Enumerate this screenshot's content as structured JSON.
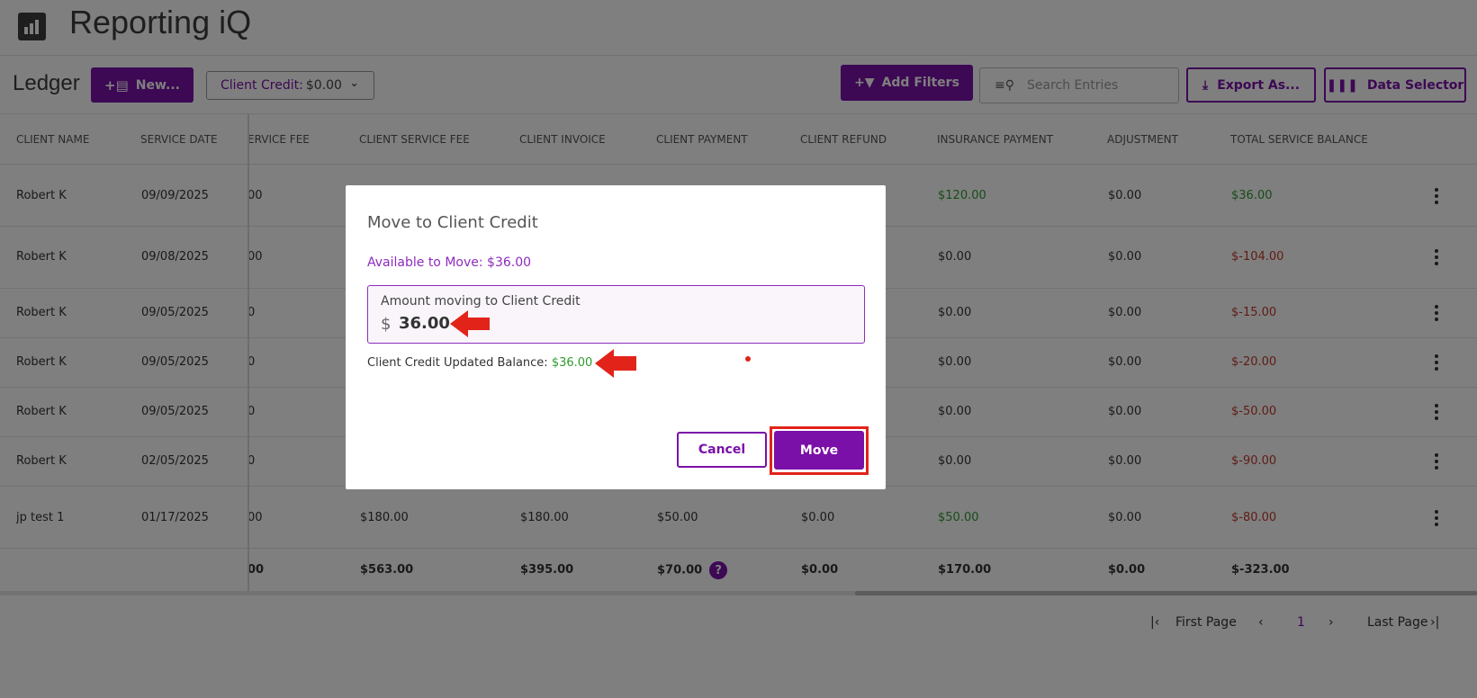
{
  "app": {
    "title": "Reporting iQ"
  },
  "toolbar": {
    "heading": "Ledger",
    "new_label": "New...",
    "client_credit_label": "Client Credit:",
    "client_credit_value": "$0.00",
    "add_filters_label": "Add Filters",
    "search_placeholder": "Search Entries",
    "export_label": "Export As...",
    "data_selector_label": "Data Selector"
  },
  "table": {
    "columns": [
      "CLIENT NAME",
      "SERVICE DATE",
      "ERVICE FEE",
      "CLIENT SERVICE FEE",
      "CLIENT INVOICE",
      "CLIENT PAYMENT",
      "CLIENT REFUND",
      "INSURANCE PAYMENT",
      "ADJUSTMENT",
      "TOTAL SERVICE BALANCE"
    ],
    "rows": [
      {
        "client": "Robert K",
        "date": "09/09/2025",
        "fee_partial": "00",
        "insurance_payment": "$120.00",
        "adjustment": "$0.00",
        "balance": "$36.00"
      },
      {
        "client": "Robert K",
        "date": "09/08/2025",
        "fee_partial": "00",
        "insurance_payment": "$0.00",
        "adjustment": "$0.00",
        "balance": "$-104.00"
      },
      {
        "client": "Robert K",
        "date": "09/05/2025",
        "fee_partial": "0",
        "insurance_payment": "$0.00",
        "adjustment": "$0.00",
        "balance": "$-15.00"
      },
      {
        "client": "Robert K",
        "date": "09/05/2025",
        "fee_partial": "0",
        "insurance_payment": "$0.00",
        "adjustment": "$0.00",
        "balance": "$-20.00"
      },
      {
        "client": "Robert K",
        "date": "09/05/2025",
        "fee_partial": "0",
        "insurance_payment": "$0.00",
        "adjustment": "$0.00",
        "balance": "$-50.00"
      },
      {
        "client": "Robert K",
        "date": "02/05/2025",
        "fee_partial": "0",
        "insurance_payment": "$0.00",
        "adjustment": "$0.00",
        "balance": "$-90.00"
      },
      {
        "client": "jp test 1",
        "date": "01/17/2025",
        "fee_partial": "00",
        "client_service_fee": "$180.00",
        "client_invoice": "$180.00",
        "client_payment": "$50.00",
        "client_refund": "$0.00",
        "insurance_payment": "$50.00",
        "adjustment": "$0.00",
        "balance": "$-80.00"
      }
    ],
    "totals": {
      "fee_partial": "00",
      "client_service_fee": "$563.00",
      "client_invoice": "$395.00",
      "client_payment": "$70.00",
      "help_icon": "?",
      "client_refund": "$0.00",
      "insurance_payment": "$170.00",
      "adjustment": "$0.00",
      "balance": "$-323.00"
    }
  },
  "pagination": {
    "first_label": "First Page",
    "current_page": "1",
    "last_label": "Last Page"
  },
  "modal": {
    "title": "Move to Client Credit",
    "available": "Available to Move: $36.00",
    "amount_label": "Amount moving to Client Credit",
    "currency": "$",
    "amount_value": "36.00",
    "updated_label": "Client Credit Updated Balance:",
    "updated_value": "$36.00",
    "cancel_label": "Cancel",
    "move_label": "Move"
  },
  "colors": {
    "brand_purple": "#7a10a8",
    "positive_green": "#2f9a2f",
    "negative_red": "#c0392b",
    "annotation_red": "#e2231a"
  },
  "icons": [
    "chart-logo-icon",
    "new-document-icon",
    "chevron-down-icon",
    "filter-icon",
    "search-list-icon",
    "download-icon",
    "columns-icon",
    "kebab-menu-icon",
    "first-page-icon",
    "chevron-left-icon",
    "chevron-right-icon",
    "last-page-icon",
    "help-icon",
    "red-arrow-icon"
  ]
}
